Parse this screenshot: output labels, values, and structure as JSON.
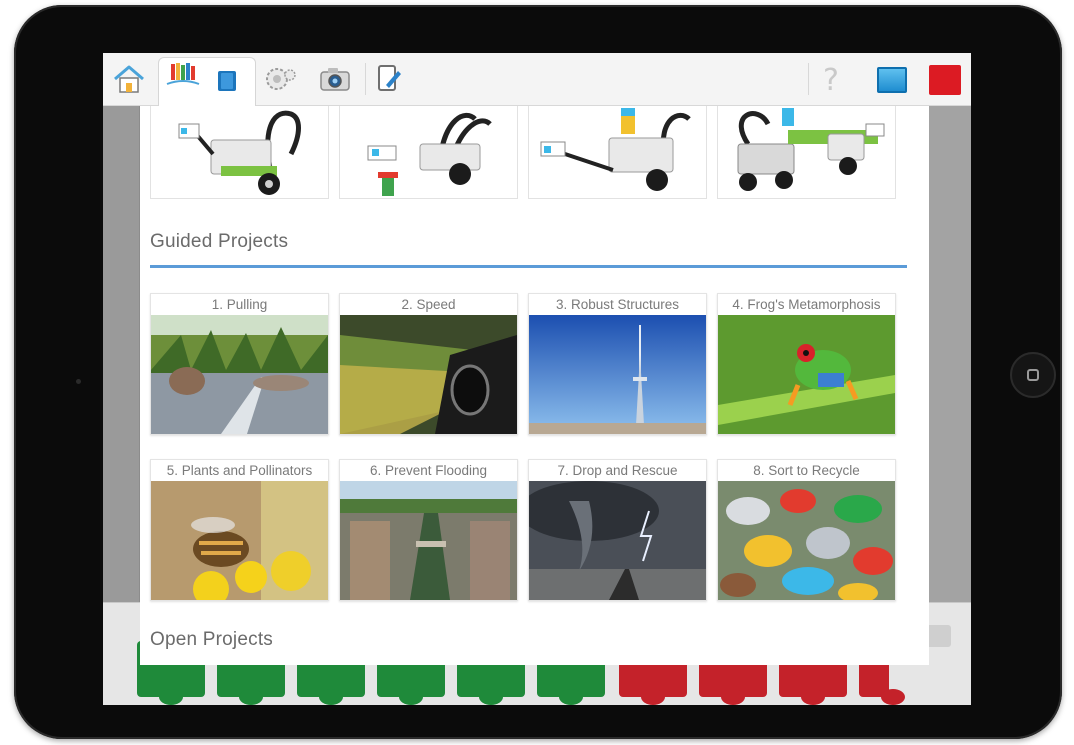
{
  "toolbar": {
    "home_icon": "home-icon",
    "projects_icon": "projects-library-icon",
    "book_icon": "book-icon",
    "gears_icon": "gears-icon",
    "camera_icon": "camera-icon",
    "tablet_icon": "tablet-icon",
    "help_label": "?",
    "colors": {
      "blue_button": "#1f8dd0",
      "red_button": "#dc1b23"
    }
  },
  "robot_models": [
    {
      "name": "robot-model-1"
    },
    {
      "name": "robot-model-2"
    },
    {
      "name": "robot-model-3"
    },
    {
      "name": "robot-model-4"
    }
  ],
  "guided": {
    "title": "Guided Projects",
    "accent": "#5b9bd8",
    "projects": [
      {
        "label": "1. Pulling"
      },
      {
        "label": "2. Speed"
      },
      {
        "label": "3. Robust Structures"
      },
      {
        "label": "4. Frog's Metamorphosis"
      },
      {
        "label": "5. Plants and Pollinators"
      },
      {
        "label": "6. Prevent Flooding"
      },
      {
        "label": "7. Drop and Rescue"
      },
      {
        "label": "8. Sort to Recycle"
      }
    ]
  },
  "open": {
    "title": "Open Projects"
  }
}
